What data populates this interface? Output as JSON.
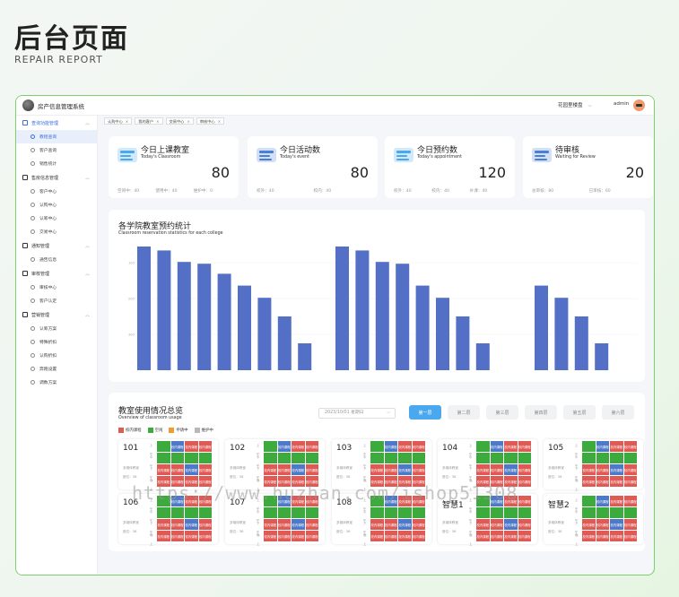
{
  "header": {
    "title": "后台页面",
    "subtitle": "REPAIR REPORT"
  },
  "app": {
    "title": "房产信息管理系统",
    "org": "花园里楼盘",
    "user": "admin"
  },
  "sidebar": {
    "groups": [
      {
        "label": "查询功能管理",
        "items": [
          "教程查询",
          "客户查询",
          "销售统计"
        ]
      },
      {
        "label": "售房信息管理",
        "items": [
          "客户中心",
          "认购中心",
          "认筹中心",
          "交易中心"
        ]
      },
      {
        "label": "通知管理",
        "items": [
          "通告信息"
        ]
      },
      {
        "label": "审核管理",
        "items": [
          "审核中心",
          "客户认定"
        ]
      },
      {
        "label": "营销管理",
        "items": [
          "认筹方案",
          "特殊折扣",
          "认购折扣",
          "奔跑设置",
          "调数方案"
        ]
      }
    ]
  },
  "tabs": [
    {
      "label": "认购中心"
    },
    {
      "label": "我的客户"
    },
    {
      "label": "交易中心"
    },
    {
      "label": "审核中心"
    }
  ],
  "stats": [
    {
      "title": "今日上课教室",
      "subtitle": "Today's Classroom",
      "value": "80",
      "footer": [
        "空闲中：40",
        "使用中：40",
        "维护中：0"
      ],
      "color": "#4aa8ee"
    },
    {
      "title": "今日活动数",
      "subtitle": "Today's event",
      "value": "80",
      "footer": [
        "校外：40",
        "校内：40"
      ],
      "color": "#4a7fd8"
    },
    {
      "title": "今日预约数",
      "subtitle": "Today's appointment",
      "value": "120",
      "footer": [
        "校外：40",
        "校内：40",
        "补课：40"
      ],
      "color": "#4aa8ee"
    },
    {
      "title": "待审核",
      "subtitle": "Waiting for Review",
      "value": "20",
      "footer": [
        "总审核：80",
        "已审核：60"
      ],
      "color": "#4a7fd8"
    }
  ],
  "reservation_chart": {
    "title": "各学院教室预约统计",
    "subtitle": "Classroom reservation statistics for each college",
    "bar_color": "#5470c6",
    "tick_labels": [
      "300",
      "200",
      "100"
    ]
  },
  "chart_data": {
    "type": "bar",
    "title": "各学院教室预约统计",
    "subtitle": "Classroom reservation statistics for each college",
    "ylim": [
      0,
      350
    ],
    "yticks": [
      100,
      200,
      300
    ],
    "grid": false,
    "series": [
      {
        "values": [
          345,
          334,
          302,
          297,
          269,
          236,
          202,
          150,
          75
        ]
      },
      {
        "values": [
          345,
          334,
          302,
          297,
          236,
          202,
          150,
          75
        ]
      },
      {
        "values": [
          236,
          202,
          150,
          75
        ]
      }
    ]
  },
  "usage": {
    "title": "教室使用情况总览",
    "subtitle": "Overview of classroom usage",
    "date": "2023/10/01 星期日",
    "floors": [
      "第一层",
      "第二层",
      "第三层",
      "第四层",
      "第五层",
      "第六层"
    ],
    "legend": [
      {
        "label": "校内课程",
        "color": "#e05a55"
      },
      {
        "label": "空闲",
        "color": "#3caa3c"
      },
      {
        "label": "申请中",
        "color": "#f09a2f"
      },
      {
        "label": "维护中",
        "color": "#b8b8b8"
      }
    ],
    "slot_labels": [
      "上午",
      "中午",
      "下午",
      "晚上"
    ],
    "room_sub1": "多媒体教室",
    "room_sub2": "座位：36",
    "rooms": [
      "101",
      "102",
      "103",
      "104",
      "105",
      "106",
      "107",
      "108",
      "智慧1",
      "智慧2"
    ]
  },
  "watermark": "https://www.huzhan.com/ishop51308"
}
